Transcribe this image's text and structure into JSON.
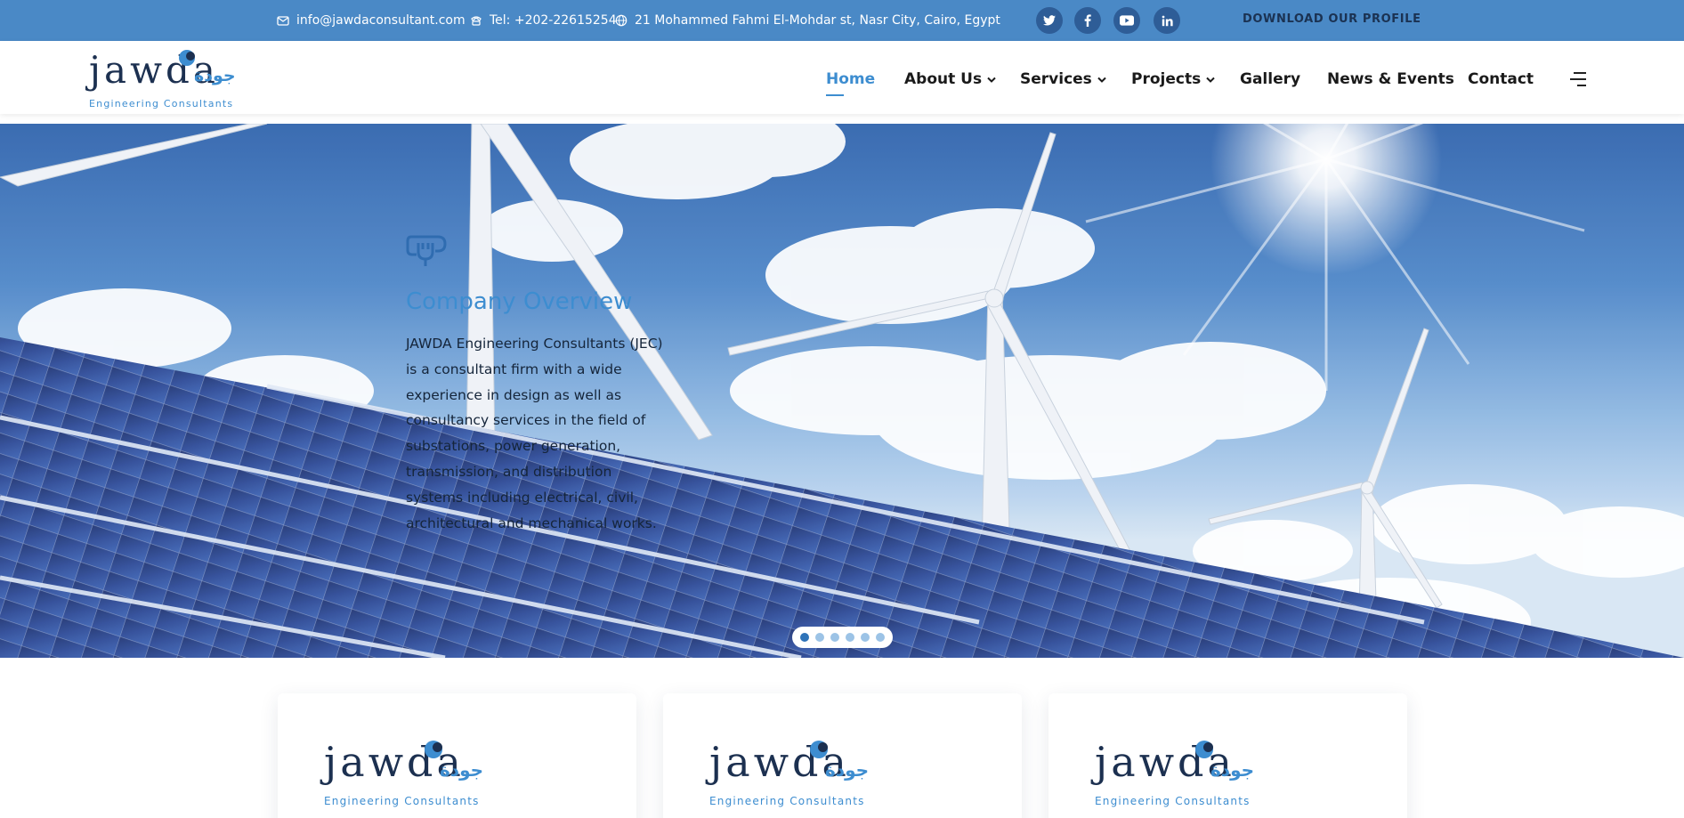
{
  "topbar": {
    "email": "info@jawdaconsultant.com",
    "tel": "Tel: +202-22615254",
    "address": "21 Mohammed Fahmi El-Mohdar st, Nasr City, Cairo, Egypt",
    "social_icons": [
      "twitter-icon",
      "facebook-icon",
      "youtube-icon",
      "linkedin-icon"
    ],
    "download_label": "DOWNLOAD OUR PROFILE"
  },
  "logo": {
    "latin": "jawda",
    "arabic": "جودة",
    "tagline": "Engineering Consultants"
  },
  "nav": {
    "items": [
      {
        "label": "Home",
        "active": true
      },
      {
        "label": "About Us",
        "dropdown": true
      },
      {
        "label": "Services",
        "dropdown": true
      },
      {
        "label": "Projects",
        "dropdown": true
      },
      {
        "label": "Gallery"
      },
      {
        "label": "News & Events"
      },
      {
        "label": "Contact"
      }
    ],
    "menu_icon": "hamburger-menu-icon"
  },
  "hero": {
    "icon": "plug-icon",
    "title": "Company Overview",
    "text": "JAWDA Engineering Consultants (JEC) is a consultant firm with a wide experience in design as well as consultancy services in the field of substations, power generation, transmission, and distribution systems including electrical, civil, architectural and mechanical works.",
    "slides_count": 6,
    "active_slide": 1
  },
  "cards": [
    {
      "logo_latin": "jawda",
      "logo_arabic": "جودة",
      "logo_tagline": "Engineering Consultants"
    },
    {
      "logo_latin": "jawda",
      "logo_arabic": "جودة",
      "logo_tagline": "Engineering Consultants"
    },
    {
      "logo_latin": "jawda",
      "logo_arabic": "جودة",
      "logo_tagline": "Engineering Consultants"
    }
  ],
  "colors": {
    "topbar": "#4a89c6",
    "accent": "#3d8dd0",
    "navy": "#1c3050"
  }
}
